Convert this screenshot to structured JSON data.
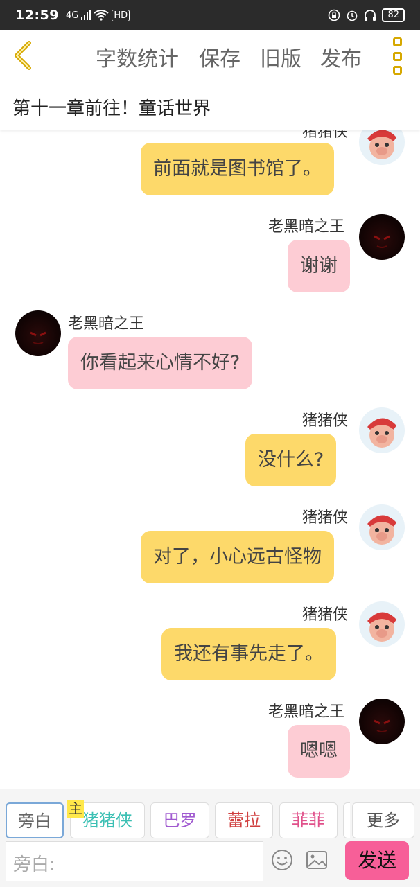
{
  "status_bar": {
    "time": "12:59",
    "network": "4G",
    "hd": "HD",
    "battery": "82"
  },
  "toolbar": {
    "word_count": "字数统计",
    "save": "保存",
    "old_version": "旧版",
    "publish": "发布"
  },
  "chapter_title": "第十一章前往！童话世界",
  "messages": [
    {
      "sender": "猪猪侠",
      "text": "前面就是图书馆了。",
      "side": "right",
      "color": "yellow"
    },
    {
      "sender": "老黑暗之王",
      "text": "谢谢",
      "side": "right",
      "color": "pink"
    },
    {
      "sender": "老黑暗之王",
      "text": "你看起来心情不好?",
      "side": "left",
      "color": "pink"
    },
    {
      "sender": "猪猪侠",
      "text": "没什么?",
      "side": "right",
      "color": "yellow"
    },
    {
      "sender": "猪猪侠",
      "text": "对了，小心远古怪物",
      "side": "right",
      "color": "yellow"
    },
    {
      "sender": "猪猪侠",
      "text": "我还有事先走了。",
      "side": "right",
      "color": "yellow"
    },
    {
      "sender": "老黑暗之王",
      "text": "嗯嗯",
      "side": "right",
      "color": "pink"
    }
  ],
  "roles": [
    {
      "label": "旁白",
      "color": "#666666",
      "active": true
    },
    {
      "label": "猪猪侠",
      "color": "#3cc0b4",
      "master_tag": "主"
    },
    {
      "label": "巴罗",
      "color": "#a05ad0"
    },
    {
      "label": "蕾拉",
      "color": "#d04040"
    },
    {
      "label": "菲菲",
      "color": "#e0508a"
    },
    {
      "label": "更多",
      "color": "#555555"
    }
  ],
  "input": {
    "placeholder": "旁白:",
    "send_label": "发送"
  },
  "icons": {
    "back": "back-chevron-icon",
    "more": "more-menu-icon",
    "emoji": "emoji-icon",
    "image": "image-icon"
  },
  "colors": {
    "accent_yellow": "#fdd96a",
    "accent_pink": "#fdccd4",
    "send_button": "#f75f98",
    "icon_gold": "#d6a800"
  }
}
